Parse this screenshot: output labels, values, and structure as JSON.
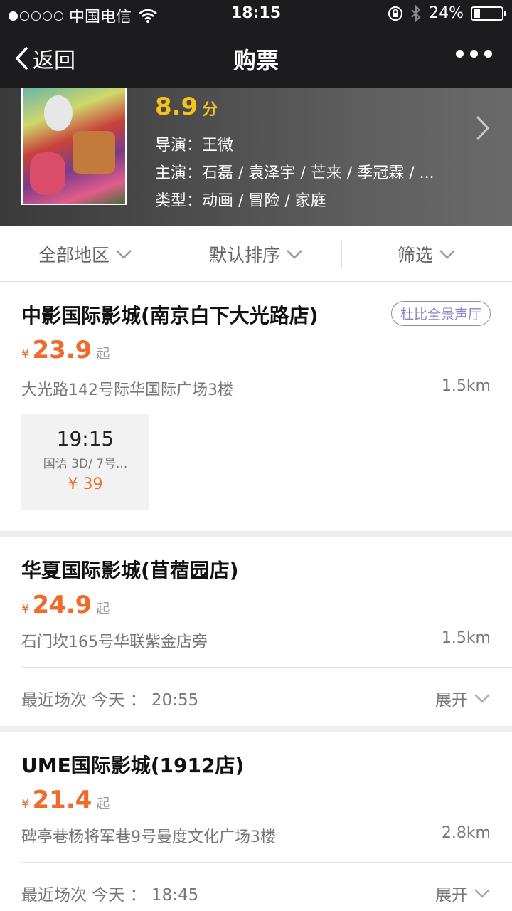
{
  "status_bar": {
    "carrier": "中国电信",
    "time": "18:15",
    "battery": "24%",
    "battery_level": 0.24,
    "signal_bars": 1
  },
  "nav": {
    "back_label": "返回",
    "title": "购票"
  },
  "movie": {
    "rating": "8.9",
    "rating_unit": "分",
    "director": "导演：王微",
    "cast": "主演：石磊 / 袁泽宇 / 芒来 / 季冠霖 / ...",
    "genre": "类型：动画 / 冒险 / 家庭"
  },
  "filters": [
    "全部地区",
    "默认排序",
    "筛选"
  ],
  "cinemas": [
    {
      "name": "中影国际影城(南京白下大光路店)",
      "badge": "杜比全景声厅",
      "price_symbol": "¥",
      "price": "23.9",
      "price_suffix": "起",
      "address": "大光路142号际华国际广场3楼",
      "distance": "1.5km",
      "showtime": {
        "time": "19:15",
        "desc": "国语 3D/ 7号...",
        "price": "¥ 39"
      }
    },
    {
      "name": "华夏国际影城(苜蓿园店)",
      "price_symbol": "¥",
      "price": "24.9",
      "price_suffix": "起",
      "address": "石门坎165号华联紫金店旁",
      "distance": "1.5km",
      "recent": "最近场次  今天 ：  20:55",
      "expand": "展开"
    },
    {
      "name": "UME国际影城(1912店)",
      "price_symbol": "¥",
      "price": "21.4",
      "price_suffix": "起",
      "address": "碑亭巷杨将军巷9号曼度文化广场3楼",
      "distance": "2.8km",
      "recent": "最近场次  今天 ：  18:45",
      "expand": "展开"
    }
  ],
  "colors": {
    "header_bg": "#1c1c1e",
    "rating": "#f5c11c",
    "price": "#f06b2b",
    "badge": "#8f86c9"
  }
}
